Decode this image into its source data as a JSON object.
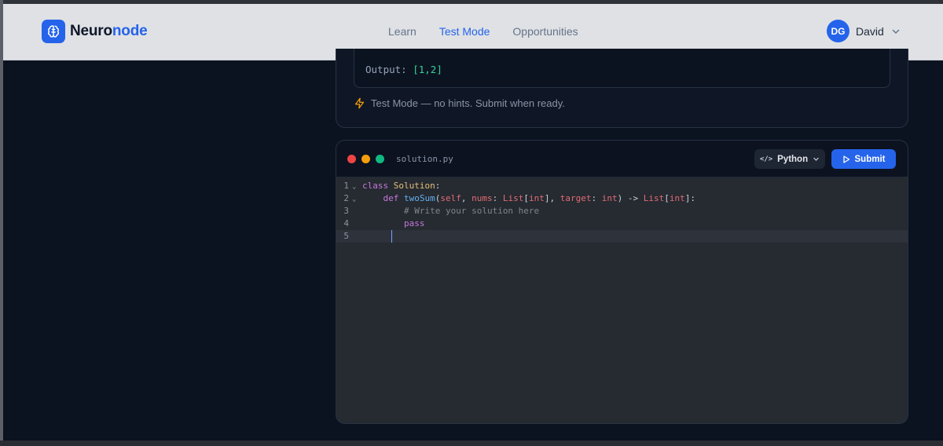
{
  "brand": {
    "name_part1": "Neuro",
    "name_part2": "node",
    "accent_color": "#2563eb"
  },
  "nav": {
    "links": [
      {
        "label": "Learn",
        "active": false
      },
      {
        "label": "Test Mode",
        "active": true
      },
      {
        "label": "Opportunities",
        "active": false
      }
    ]
  },
  "user": {
    "initials": "DG",
    "name": "David"
  },
  "problem": {
    "output_label": "Output:",
    "output_value": "[1,2]",
    "mode_note": "Test Mode — no hints. Submit when ready."
  },
  "editor": {
    "filename": "solution.py",
    "language": "Python",
    "submit_label": "Submit",
    "current_line": 5,
    "lines": [
      {
        "n": "1",
        "fold": true
      },
      {
        "n": "2",
        "fold": true
      },
      {
        "n": "3",
        "fold": false
      },
      {
        "n": "4",
        "fold": false
      },
      {
        "n": "5",
        "fold": false
      }
    ],
    "code": {
      "l1_kw": "class",
      "l1_name": "Solution",
      "l1_rest": ":",
      "l2_kw": "def",
      "l2_fn": "twoSum",
      "l2_p1": "self",
      "l2_p2": "nums",
      "l2_t1": "List",
      "l2_t2": "int",
      "l2_p3": "target",
      "l2_t3": "int",
      "l2_t4": "List",
      "l2_t5": "int",
      "l3_comment": "# Write your solution here",
      "l4_kw": "pass"
    }
  }
}
